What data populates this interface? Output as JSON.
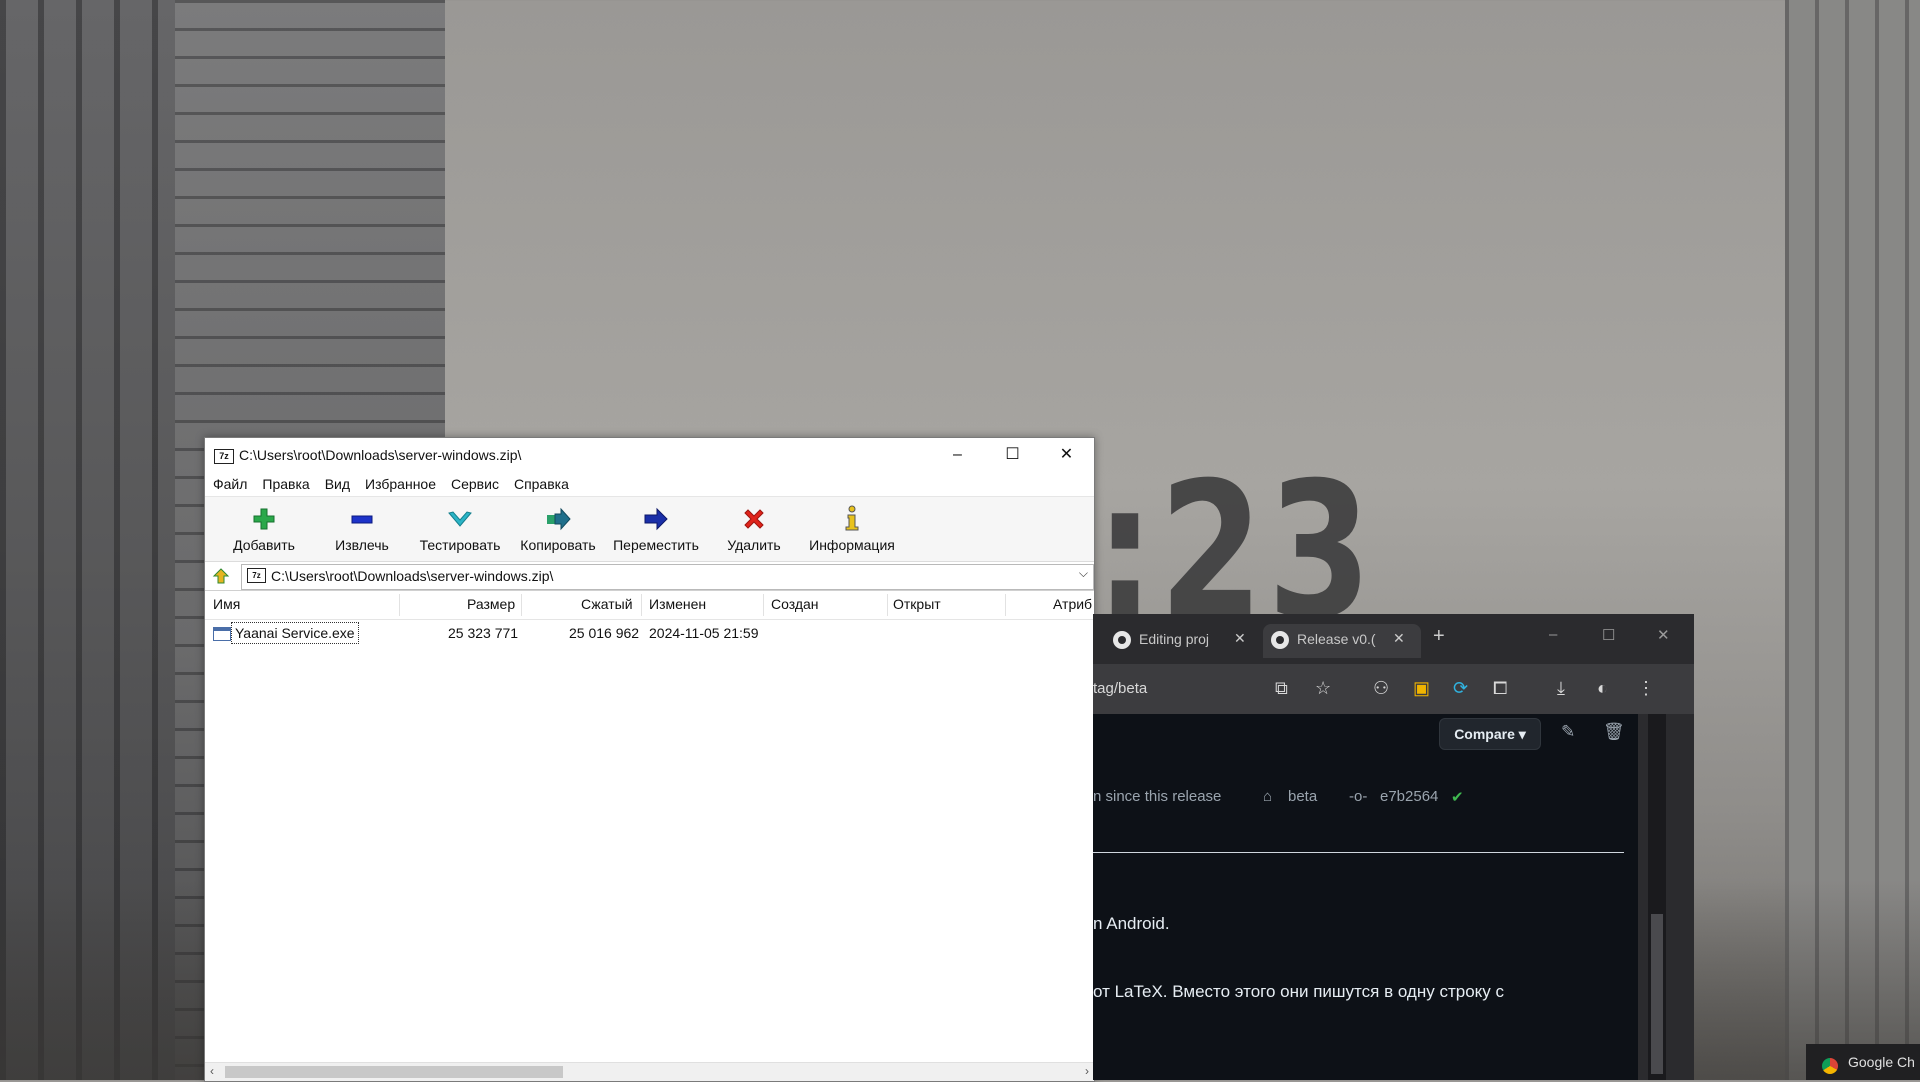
{
  "desktop": {
    "clock_fragment": ":23"
  },
  "sevenzip": {
    "title_icon": "7z",
    "title": "C:\\Users\\root\\Downloads\\server-windows.zip\\",
    "window_controls": {
      "minimize": "–",
      "maximize": "☐",
      "close": "✕"
    },
    "menu": [
      "Файл",
      "Правка",
      "Вид",
      "Избранное",
      "Сервис",
      "Справка"
    ],
    "toolbar": [
      {
        "label": "Добавить",
        "icon": "plus-icon"
      },
      {
        "label": "Извлечь",
        "icon": "minus-icon"
      },
      {
        "label": "Тестировать",
        "icon": "check-icon"
      },
      {
        "label": "Копировать",
        "icon": "copy-arrow-icon"
      },
      {
        "label": "Переместить",
        "icon": "move-arrow-icon"
      },
      {
        "label": "Удалить",
        "icon": "delete-x-icon"
      },
      {
        "label": "Информация",
        "icon": "info-icon"
      }
    ],
    "address": {
      "icon": "7z",
      "path": "C:\\Users\\root\\Downloads\\server-windows.zip\\"
    },
    "columns": [
      "Имя",
      "Размер",
      "Сжатый",
      "Изменен",
      "Создан",
      "Открыт",
      "Атриб"
    ],
    "rows": [
      {
        "name": "Yaanai Service.exe",
        "size": "25 323 771",
        "packed": "25 016 962",
        "modified": "2024-11-05 21:59"
      }
    ]
  },
  "chrome": {
    "tabs": [
      {
        "title": "Editing proj"
      },
      {
        "title": "Release v0.("
      }
    ],
    "new_tab": "+",
    "address_text": "tag/beta",
    "page": {
      "compare_label": "Compare ▾",
      "since_text": "n since this release",
      "tag_label": "beta",
      "commit": "e7b2564",
      "line1": "n Android.",
      "line2": "от LaTeX. Вместо этого они пишутся в одну строку с"
    }
  },
  "taskbar": {
    "label": "Google Ch"
  }
}
